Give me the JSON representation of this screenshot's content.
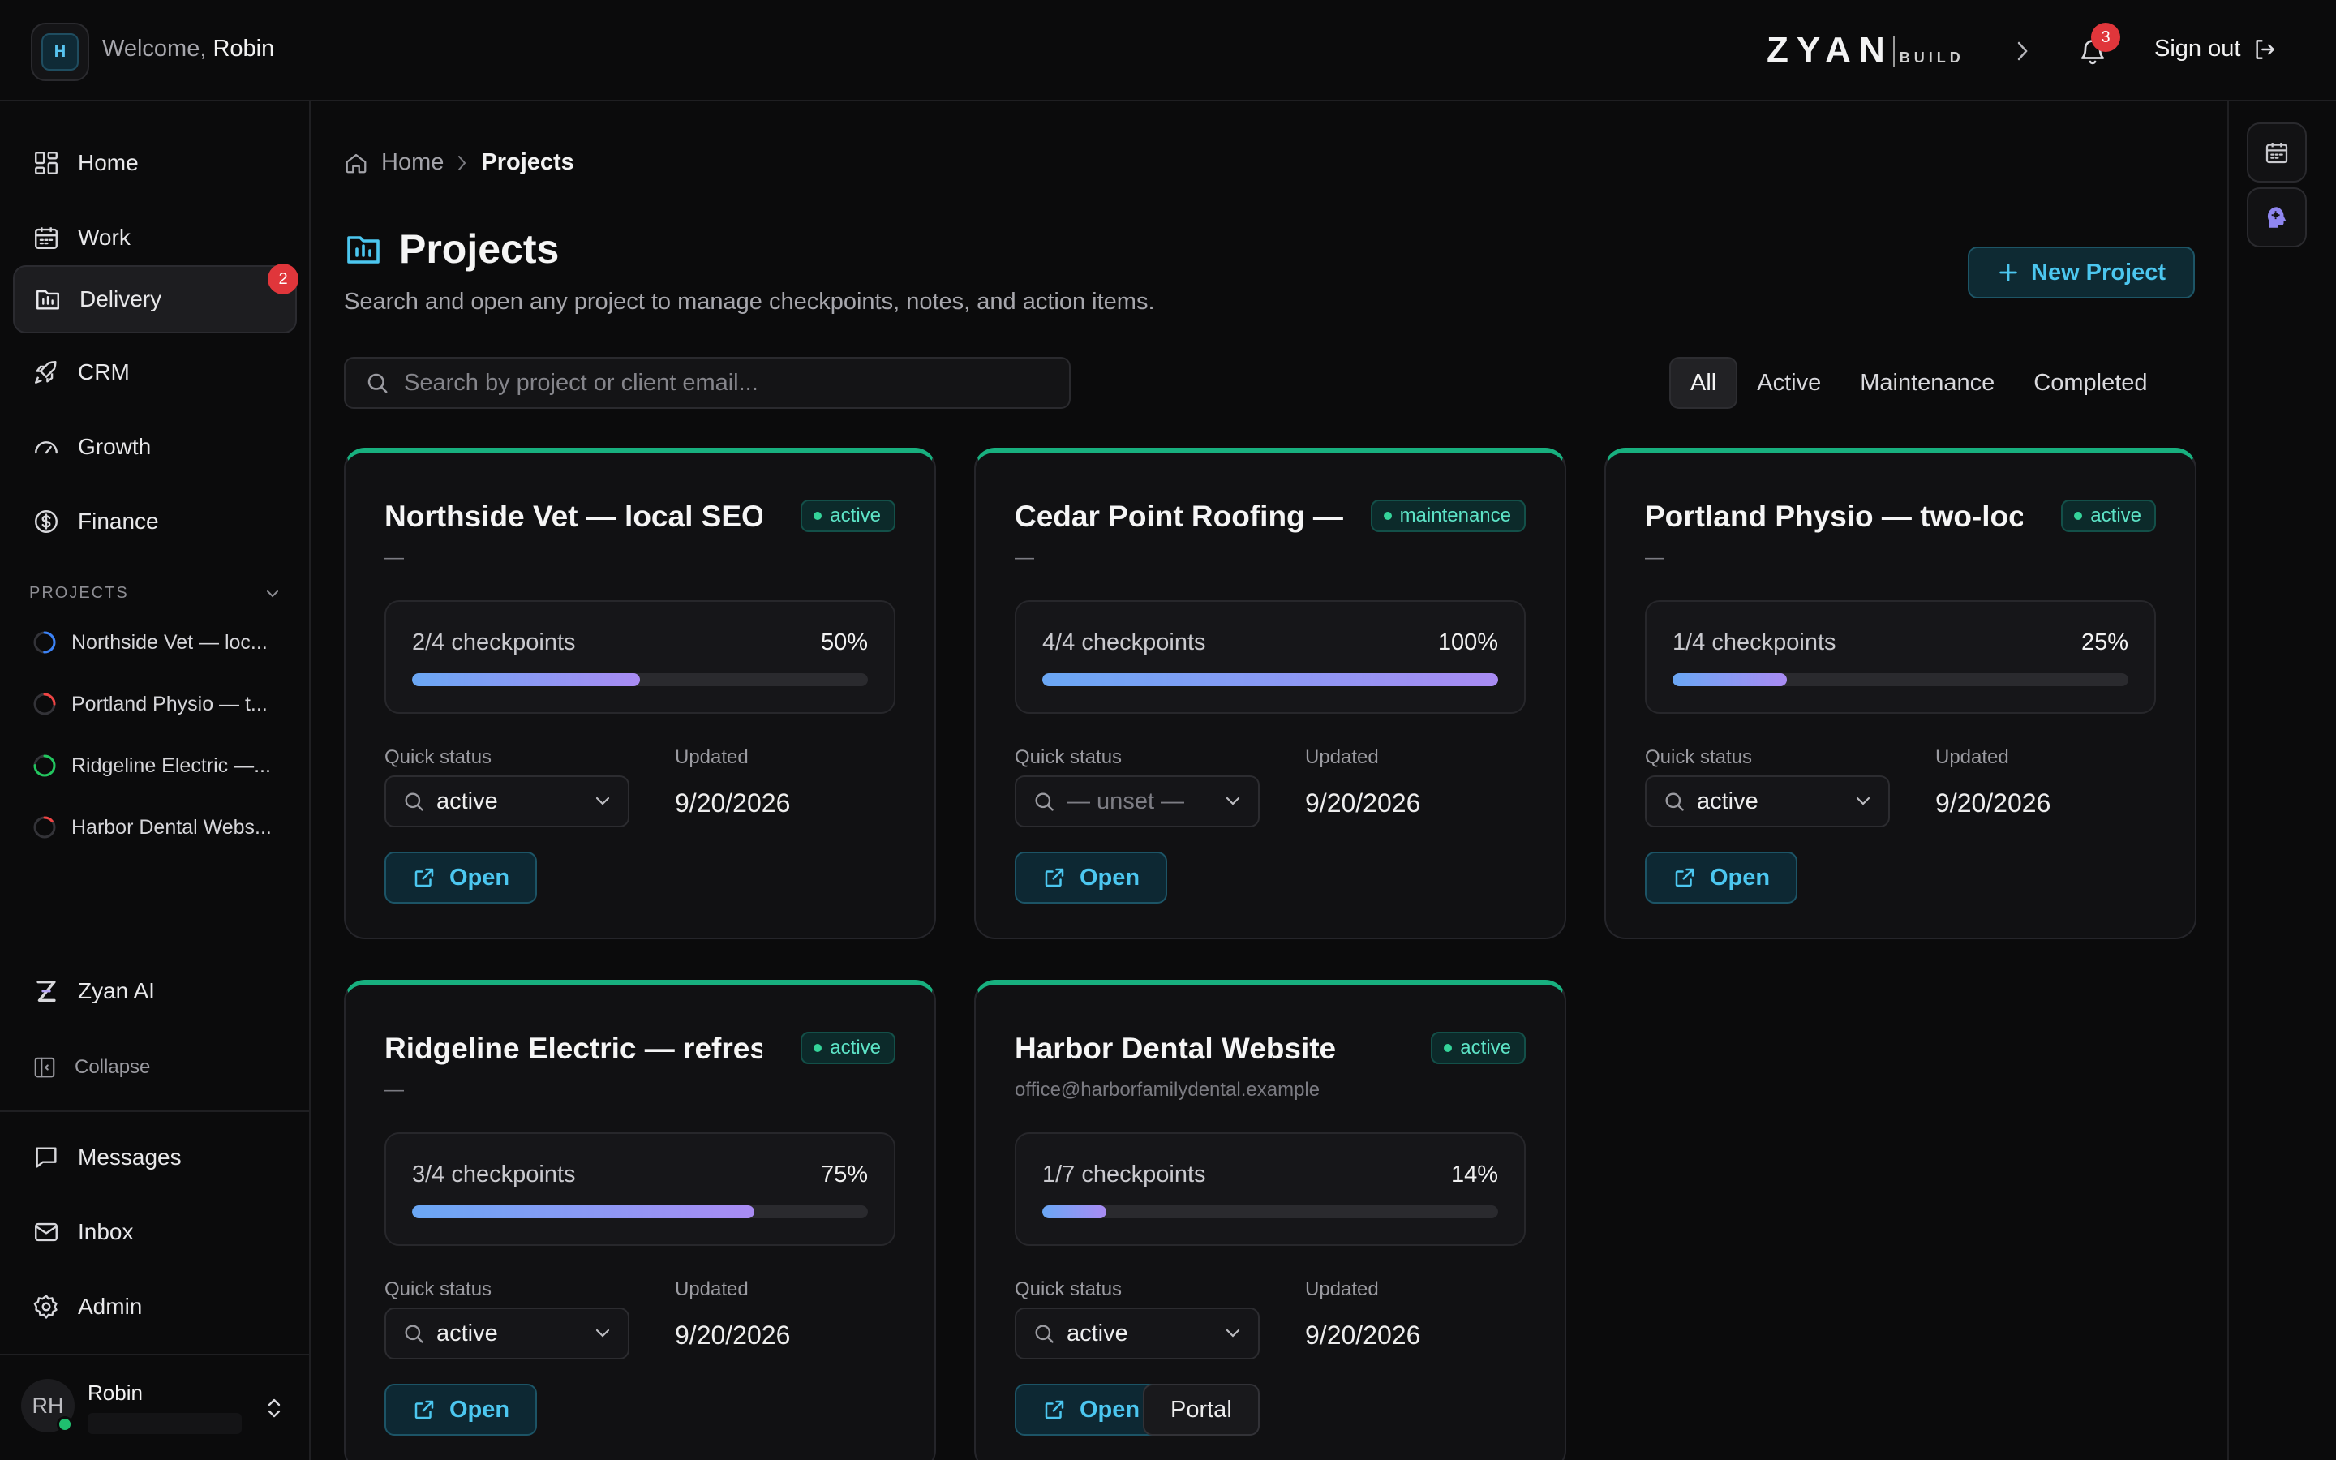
{
  "header": {
    "workspace_initial": "H",
    "welcome_prefix": "Welcome,",
    "welcome_name": "Robin",
    "logo_main": "ZYAN",
    "logo_sub": "BUILD",
    "notification_count": "3",
    "sign_out_label": "Sign out"
  },
  "sidebar": {
    "nav": [
      {
        "label": "Home",
        "icon": "dashboard-icon"
      },
      {
        "label": "Work",
        "icon": "calendar-icon"
      },
      {
        "label": "Delivery",
        "icon": "delivery-icon",
        "badge": "2",
        "active": true
      },
      {
        "label": "CRM",
        "icon": "rocket-icon"
      },
      {
        "label": "Growth",
        "icon": "gauge-icon"
      },
      {
        "label": "Finance",
        "icon": "dollar-icon"
      }
    ],
    "projects_header": "PROJECTS",
    "projects": [
      {
        "label": "Northside Vet — loc...",
        "ring_color": "#3b82f6",
        "progress": 0.5
      },
      {
        "label": "Portland Physio — t...",
        "ring_color": "#ef4444",
        "progress": 0.25
      },
      {
        "label": "Ridgeline Electric —...",
        "ring_color": "#22c55e",
        "progress": 0.75
      },
      {
        "label": "Harbor Dental Webs...",
        "ring_color": "#ef4444",
        "progress": 0.14
      }
    ],
    "zyan_ai_label": "Zyan AI",
    "collapse_label": "Collapse",
    "bottom_nav": [
      {
        "label": "Messages",
        "icon": "message-icon"
      },
      {
        "label": "Inbox",
        "icon": "mail-icon"
      },
      {
        "label": "Admin",
        "icon": "gear-icon"
      }
    ],
    "user": {
      "initials": "RH",
      "name": "Robin"
    }
  },
  "breadcrumb": {
    "home": "Home",
    "current": "Projects"
  },
  "page": {
    "title": "Projects",
    "subtitle": "Search and open any project to manage checkpoints, notes, and action items.",
    "new_project_label": "New Project"
  },
  "search": {
    "placeholder": "Search by project or client email...",
    "value": ""
  },
  "filters": [
    {
      "label": "All",
      "active": true
    },
    {
      "label": "Active",
      "active": false
    },
    {
      "label": "Maintenance",
      "active": false
    },
    {
      "label": "Completed",
      "active": false
    }
  ],
  "colors": {
    "accent": "#4cc7f0",
    "status_green": "#34d399",
    "card_top": "#18b07f",
    "badge_red": "#e0363b"
  },
  "card_labels": {
    "quick_status": "Quick status",
    "updated": "Updated",
    "open": "Open",
    "portal": "Portal"
  },
  "cards": [
    {
      "title": "Northside Vet — local SEO",
      "status": "active",
      "subtitle": "—",
      "checkpoints": "2/4 checkpoints",
      "percent": "50%",
      "progress": 0.5,
      "quick_status": "active",
      "updated": "9/20/2026",
      "portal": false
    },
    {
      "title": "Cedar Point Roofing —",
      "status": "maintenance",
      "subtitle": "—",
      "checkpoints": "4/4 checkpoints",
      "percent": "100%",
      "progress": 1.0,
      "quick_status": "— unset —",
      "updated": "9/20/2026",
      "portal": false
    },
    {
      "title": "Portland Physio — two-loca",
      "status": "active",
      "subtitle": "—",
      "checkpoints": "1/4 checkpoints",
      "percent": "25%",
      "progress": 0.25,
      "quick_status": "active",
      "updated": "9/20/2026",
      "portal": false
    },
    {
      "title": "Ridgeline Electric — refresh",
      "status": "active",
      "subtitle": "—",
      "checkpoints": "3/4 checkpoints",
      "percent": "75%",
      "progress": 0.75,
      "quick_status": "active",
      "updated": "9/20/2026",
      "portal": false
    },
    {
      "title": "Harbor Dental Website",
      "status": "active",
      "subtitle": "office@harborfamilydental.example",
      "checkpoints": "1/7 checkpoints",
      "percent": "14%",
      "progress": 0.14,
      "quick_status": "active",
      "updated": "9/20/2026",
      "portal": true
    }
  ]
}
